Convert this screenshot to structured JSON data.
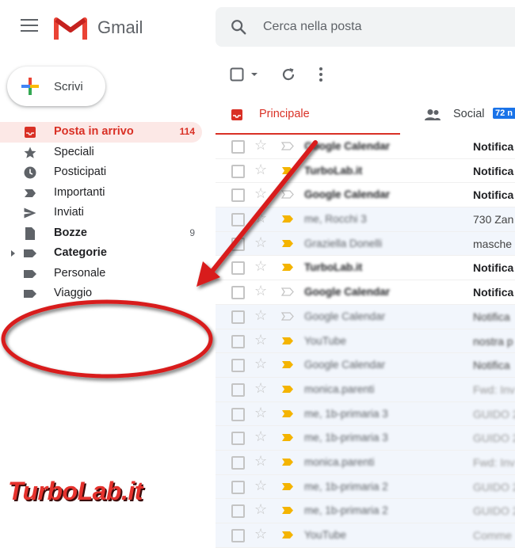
{
  "app": {
    "brand": "Gmail"
  },
  "search": {
    "placeholder": "Cerca nella posta"
  },
  "compose": {
    "label": "Scrivi"
  },
  "sidebar": {
    "items": [
      {
        "label": "Posta in arrivo",
        "count": "114",
        "icon": "inbox-icon",
        "active": true
      },
      {
        "label": "Speciali",
        "count": "",
        "icon": "star-icon"
      },
      {
        "label": "Posticipati",
        "count": "",
        "icon": "clock-icon"
      },
      {
        "label": "Importanti",
        "count": "",
        "icon": "important-icon"
      },
      {
        "label": "Inviati",
        "count": "",
        "icon": "send-icon"
      },
      {
        "label": "Bozze",
        "count": "9",
        "icon": "draft-icon",
        "bold": true
      },
      {
        "label": "Categorie",
        "count": "",
        "icon": "label-icon",
        "bold": true
      },
      {
        "label": "Personale",
        "count": "",
        "icon": "label-icon"
      },
      {
        "label": "Viaggio",
        "count": "",
        "icon": "label-icon"
      }
    ]
  },
  "tabs": [
    {
      "label": "Principale",
      "icon": "inbox-icon",
      "active": true
    },
    {
      "label": "Social",
      "icon": "people-icon",
      "badge": "72 n"
    }
  ],
  "emails": [
    {
      "sender": "Google Calendar",
      "subject": "Notifica",
      "unread": true,
      "important": false
    },
    {
      "sender": "TurboLab.it",
      "subject": "Notifica",
      "unread": true,
      "important": true
    },
    {
      "sender": "Google Calendar",
      "subject": "Notifica",
      "unread": true,
      "important": false
    },
    {
      "sender": "me, Rocchi 3",
      "subject": "730 Zan",
      "unread": false,
      "important": true
    },
    {
      "sender": "Graziella Donelli",
      "subject": "masche",
      "unread": false,
      "important": true
    },
    {
      "sender": "TurboLab.it",
      "subject": "Notifica",
      "unread": true,
      "important": true
    },
    {
      "sender": "Google Calendar",
      "subject": "Notifica",
      "unread": true,
      "important": false
    },
    {
      "sender": "Google Calendar",
      "subject": "Notifica",
      "unread": false,
      "important": false
    },
    {
      "sender": "YouTube",
      "subject": "nostra p",
      "unread": false,
      "important": true
    },
    {
      "sender": "Google Calendar",
      "subject": "Notifica",
      "unread": false,
      "important": true
    },
    {
      "sender": "monica.parenti",
      "subject": "Fwd: Inv",
      "unread": false,
      "important": true
    },
    {
      "sender": "me, 1b-primaria 3",
      "subject": "GUIDO 2",
      "unread": false,
      "important": true
    },
    {
      "sender": "me, 1b-primaria 3",
      "subject": "GUIDO 2",
      "unread": false,
      "important": true
    },
    {
      "sender": "monica.parenti",
      "subject": "Fwd: Inv",
      "unread": false,
      "important": true
    },
    {
      "sender": "me, 1b-primaria 2",
      "subject": "GUIDO 2",
      "unread": false,
      "important": true
    },
    {
      "sender": "me, 1b-primaria 2",
      "subject": "GUIDO 2",
      "unread": false,
      "important": true
    },
    {
      "sender": "YouTube",
      "subject": "Comme",
      "unread": false,
      "important": true
    }
  ],
  "watermark": {
    "text": "TurboLab.it"
  },
  "colors": {
    "accent": "#d93025",
    "annotation": "#d81e1e",
    "badge": "#1a73e8"
  }
}
